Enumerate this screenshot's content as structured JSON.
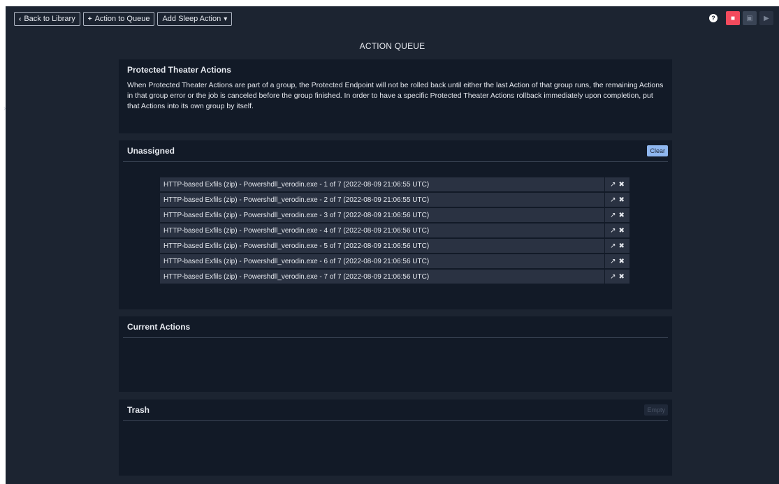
{
  "toolbar": {
    "back_label": "Back to Library",
    "add_action_label": "Action to Queue",
    "sleep_label": "Add Sleep Action"
  },
  "page": {
    "title": "ACTION QUEUE"
  },
  "protected": {
    "title": "Protected Theater Actions",
    "description": "When Protected Theater Actions are part of a group, the Protected Endpoint will not be rolled back until either the last Action of that group runs, the remaining Actions in that group error or the job is canceled before the group finished. In order to have a specific Protected Theater Actions rollback immediately upon completion, put that Actions into its own group by itself."
  },
  "unassigned": {
    "title": "Unassigned",
    "clear_label": "Clear",
    "actions": [
      {
        "label": "HTTP-based Exfils (zip) - Powershdll_verodin.exe - 1 of 7 (2022-08-09 21:06:55 UTC)"
      },
      {
        "label": "HTTP-based Exfils (zip) - Powershdll_verodin.exe - 2 of 7 (2022-08-09 21:06:55 UTC)"
      },
      {
        "label": "HTTP-based Exfils (zip) - Powershdll_verodin.exe - 3 of 7 (2022-08-09 21:06:56 UTC)"
      },
      {
        "label": "HTTP-based Exfils (zip) - Powershdll_verodin.exe - 4 of 7 (2022-08-09 21:06:56 UTC)"
      },
      {
        "label": "HTTP-based Exfils (zip) - Powershdll_verodin.exe - 5 of 7 (2022-08-09 21:06:56 UTC)"
      },
      {
        "label": "HTTP-based Exfils (zip) - Powershdll_verodin.exe - 6 of 7 (2022-08-09 21:06:56 UTC)"
      },
      {
        "label": "HTTP-based Exfils (zip) - Powershdll_verodin.exe - 7 of 7 (2022-08-09 21:06:56 UTC)"
      }
    ]
  },
  "current": {
    "title": "Current Actions"
  },
  "trash": {
    "title": "Trash",
    "empty_label": "Empty"
  },
  "icons": {
    "back": "chevron-left-icon",
    "add": "plus-icon",
    "dropdown": "caret-down-icon",
    "help": "question-circle-icon",
    "delete": "trash-icon",
    "save": "floppy-disk-icon",
    "run": "play-icon",
    "edit": "external-link-icon",
    "remove": "close-icon"
  },
  "colors": {
    "background": "#1c2431",
    "panel": "#121a27",
    "row": "#2a3242",
    "accent": "#8fb7ef",
    "danger": "#f34a5d"
  }
}
